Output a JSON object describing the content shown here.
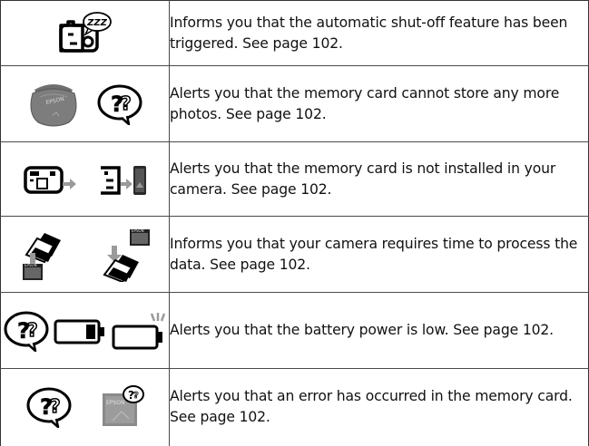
{
  "rows": [
    {
      "icons": [
        "sleep-camera-icon"
      ],
      "description": "Informs you that the automatic shut-off feature has been triggered. See page 102."
    },
    {
      "icons": [
        "full-memory-card-icon",
        "question-bubble-icon"
      ],
      "description": "Alerts you that the memory card cannot store any more photos. See page 102."
    },
    {
      "icons": [
        "camera-insert-card-icon",
        "camera-card-slot-icon"
      ],
      "description": "Alerts you that the memory card is not installed in your camera. See page 102."
    },
    {
      "icons": [
        "processing-card-to-camera-icon",
        "processing-camera-to-card-icon"
      ],
      "description": "Informs you that your camera requires time to process the data. See page 102."
    },
    {
      "icons": [
        "question-bubble-icon",
        "battery-low-icon",
        "battery-empty-icon"
      ],
      "description": "Alerts you that the battery power is low. See page 102."
    },
    {
      "icons": [
        "question-bubble-icon",
        "memory-card-error-icon"
      ],
      "description": "Alerts you that an error has occurred in the memory card. See page 102."
    }
  ],
  "card_brand": "EPSON",
  "sleep_mark": "ZZZ"
}
